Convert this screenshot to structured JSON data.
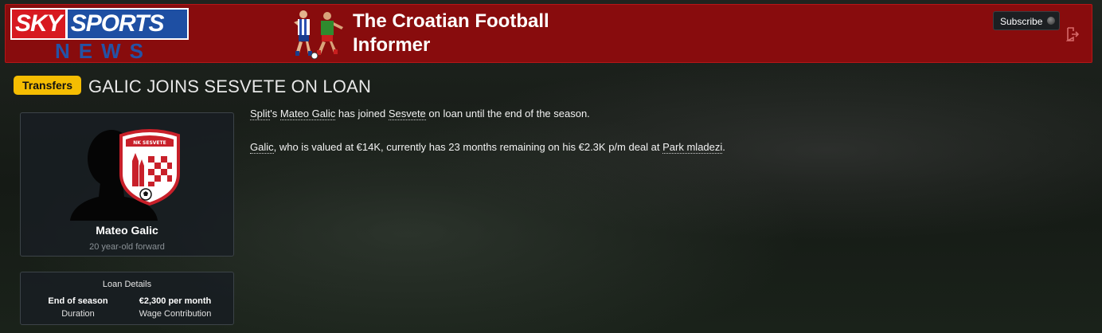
{
  "header": {
    "logo": {
      "sky": "SKY",
      "sports": "SPORTS",
      "news": "NEWS"
    },
    "title": "The Croatian Football Informer",
    "subscribe_label": "Subscribe"
  },
  "article": {
    "category": "Transfers",
    "headline": "GALIC JOINS SESVETE ON LOAN",
    "paragraph1": {
      "player_club": "Split",
      "possessive": "'s",
      "player": "Mateo Galic",
      "text_a": "has joined",
      "club": "Sesvete",
      "text_b": "on loan until the end of the season."
    },
    "paragraph2": {
      "player": "Galic",
      "text_a": ", who is valued at €14K, currently has 23 months remaining on his €2.3K p/m deal at",
      "club": "Park mladezi",
      "text_b": "."
    }
  },
  "player_card": {
    "name": "Mateo Galic",
    "description": "20 year-old forward",
    "crest_text": "NK SESVETE"
  },
  "loan_details": {
    "title": "Loan Details",
    "end_value": "End of season",
    "end_label": "Duration",
    "wage_value": "€2,300 per month",
    "wage_label": "Wage Contribution"
  },
  "colors": {
    "banner": "#880c0d",
    "tag": "#f5bd02",
    "sky_red": "#d71920",
    "sports_blue": "#1e4fa3"
  },
  "icons": [
    "players-illustration",
    "toggle-dot-icon",
    "exit-icon",
    "player-silhouette-icon",
    "club-crest-icon"
  ]
}
